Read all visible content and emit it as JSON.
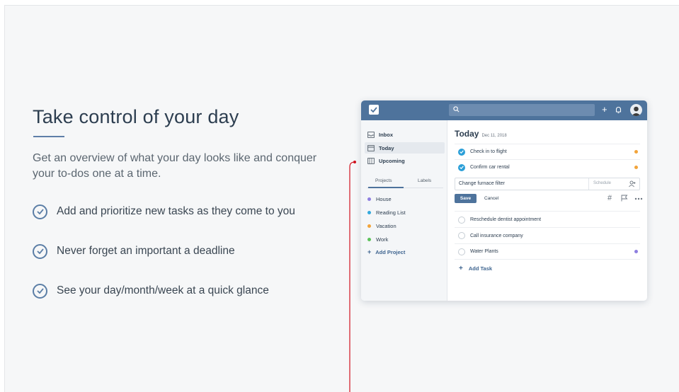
{
  "hero": {
    "title": "Take control of your day",
    "subtitle": "Get an overview of what your day looks like and conquer your to-dos one at a time.",
    "features": [
      "Add and prioritize new tasks as they come to you",
      "Never forget an important a deadline",
      "See your day/month/week at a quick glance"
    ]
  },
  "app": {
    "nav": {
      "inbox": "Inbox",
      "today": "Today",
      "upcoming": "Upcoming"
    },
    "tabs": {
      "projects": "Projects",
      "labels": "Labels"
    },
    "projects": [
      {
        "name": "House",
        "color": "#8e7fe0"
      },
      {
        "name": "Reading List",
        "color": "#33a9dd"
      },
      {
        "name": "Vacation",
        "color": "#f2a43a"
      },
      {
        "name": "Work",
        "color": "#5cc25a"
      }
    ],
    "add_project": "Add Project",
    "main": {
      "title": "Today",
      "date": "Dec 11, 2018",
      "completed_tasks": [
        {
          "label": "Check in to flight",
          "priority_color": "#f2a43a"
        },
        {
          "label": "Confirm car rental",
          "priority_color": "#f2a43a"
        }
      ],
      "edit": {
        "value": "Change furnace filter",
        "schedule_placeholder": "Schedule",
        "save": "Save",
        "cancel": "Cancel"
      },
      "tasks": [
        {
          "label": "Reschedule dentist appointment",
          "priority_color": ""
        },
        {
          "label": "Call insurance company",
          "priority_color": ""
        },
        {
          "label": "Water Plants",
          "priority_color": "#8e7fe0"
        }
      ],
      "add_task": "Add Task"
    },
    "colors": {
      "topbar": "#4e739c",
      "accent": "#2b9fd8",
      "annotation_line": "#d0131f"
    }
  }
}
